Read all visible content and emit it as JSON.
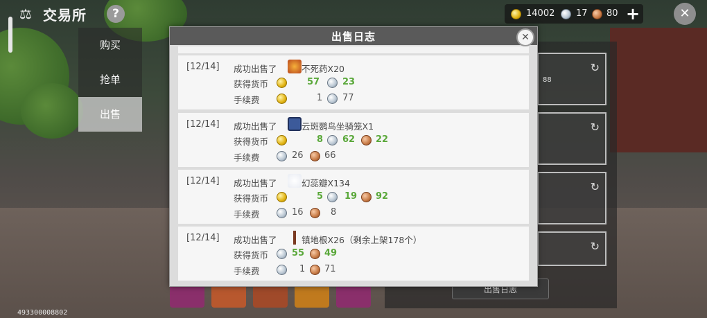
{
  "header": {
    "title": "交易所",
    "help_label": "?",
    "logo_icon": "scales-icon",
    "close_label": "✕",
    "plus_label": "+"
  },
  "wallet": {
    "gold": "14002",
    "silver": "17",
    "copper": "80"
  },
  "tabs": [
    {
      "label": "购买",
      "active": false
    },
    {
      "label": "抢单",
      "active": false
    },
    {
      "label": "出售",
      "active": true
    }
  ],
  "right_panel": {
    "slot_value": "88",
    "log_button": "出售日志"
  },
  "footer_id": "493300008802",
  "modal": {
    "title": "出售日志",
    "close_label": "✕",
    "labels": {
      "earned": "获得货币",
      "fee": "手续费"
    },
    "entries": [
      {
        "date": "[12/14]",
        "sold": "成功出售了",
        "item": "不死药X20",
        "icon": "herb-icon",
        "earned": {
          "gold": "57",
          "silver": "23"
        },
        "fee": {
          "gold": "1",
          "silver": "77"
        }
      },
      {
        "date": "[12/14]",
        "sold": "成功出售了",
        "item": "云斑鹦鸟坐骑笼X1",
        "icon": "cage-icon",
        "earned": {
          "gold": "8",
          "silver": "62",
          "copper": "22"
        },
        "fee": {
          "silver": "26",
          "copper": "66"
        }
      },
      {
        "date": "[12/14]",
        "sold": "成功出售了",
        "item": "幻蕊瓣X134",
        "icon": "petal-icon",
        "earned": {
          "gold": "5",
          "silver": "19",
          "copper": "92"
        },
        "fee": {
          "silver": "16",
          "copper": "8"
        }
      },
      {
        "date": "[12/14]",
        "sold": "成功出售了",
        "item": "镇地根X26（剩余上架178个）",
        "icon": "root-icon",
        "earned": {
          "silver": "55",
          "copper": "49"
        },
        "fee": {
          "silver": "1",
          "copper": "71"
        }
      }
    ]
  },
  "colors": {
    "accent_green": "#5aa83a",
    "modal_header": "#5a5a5a",
    "text_dark": "#4a4a4a"
  }
}
